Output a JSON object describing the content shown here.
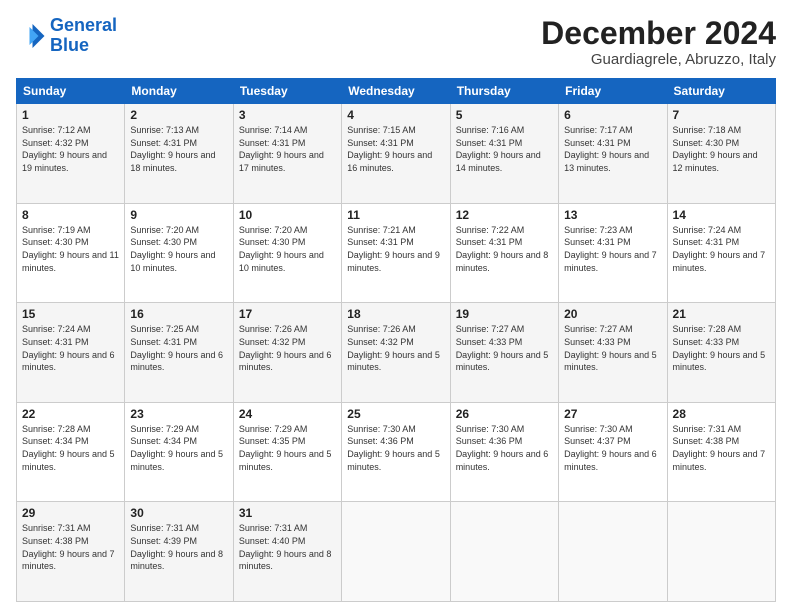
{
  "header": {
    "logo_line1": "General",
    "logo_line2": "Blue",
    "month": "December 2024",
    "location": "Guardiagrele, Abruzzo, Italy"
  },
  "weekdays": [
    "Sunday",
    "Monday",
    "Tuesday",
    "Wednesday",
    "Thursday",
    "Friday",
    "Saturday"
  ],
  "weeks": [
    [
      {
        "day": "1",
        "sunrise": "7:12 AM",
        "sunset": "4:32 PM",
        "daylight": "9 hours and 19 minutes."
      },
      {
        "day": "2",
        "sunrise": "7:13 AM",
        "sunset": "4:31 PM",
        "daylight": "9 hours and 18 minutes."
      },
      {
        "day": "3",
        "sunrise": "7:14 AM",
        "sunset": "4:31 PM",
        "daylight": "9 hours and 17 minutes."
      },
      {
        "day": "4",
        "sunrise": "7:15 AM",
        "sunset": "4:31 PM",
        "daylight": "9 hours and 16 minutes."
      },
      {
        "day": "5",
        "sunrise": "7:16 AM",
        "sunset": "4:31 PM",
        "daylight": "9 hours and 14 minutes."
      },
      {
        "day": "6",
        "sunrise": "7:17 AM",
        "sunset": "4:31 PM",
        "daylight": "9 hours and 13 minutes."
      },
      {
        "day": "7",
        "sunrise": "7:18 AM",
        "sunset": "4:30 PM",
        "daylight": "9 hours and 12 minutes."
      }
    ],
    [
      {
        "day": "8",
        "sunrise": "7:19 AM",
        "sunset": "4:30 PM",
        "daylight": "9 hours and 11 minutes."
      },
      {
        "day": "9",
        "sunrise": "7:20 AM",
        "sunset": "4:30 PM",
        "daylight": "9 hours and 10 minutes."
      },
      {
        "day": "10",
        "sunrise": "7:20 AM",
        "sunset": "4:30 PM",
        "daylight": "9 hours and 10 minutes."
      },
      {
        "day": "11",
        "sunrise": "7:21 AM",
        "sunset": "4:31 PM",
        "daylight": "9 hours and 9 minutes."
      },
      {
        "day": "12",
        "sunrise": "7:22 AM",
        "sunset": "4:31 PM",
        "daylight": "9 hours and 8 minutes."
      },
      {
        "day": "13",
        "sunrise": "7:23 AM",
        "sunset": "4:31 PM",
        "daylight": "9 hours and 7 minutes."
      },
      {
        "day": "14",
        "sunrise": "7:24 AM",
        "sunset": "4:31 PM",
        "daylight": "9 hours and 7 minutes."
      }
    ],
    [
      {
        "day": "15",
        "sunrise": "7:24 AM",
        "sunset": "4:31 PM",
        "daylight": "9 hours and 6 minutes."
      },
      {
        "day": "16",
        "sunrise": "7:25 AM",
        "sunset": "4:31 PM",
        "daylight": "9 hours and 6 minutes."
      },
      {
        "day": "17",
        "sunrise": "7:26 AM",
        "sunset": "4:32 PM",
        "daylight": "9 hours and 6 minutes."
      },
      {
        "day": "18",
        "sunrise": "7:26 AM",
        "sunset": "4:32 PM",
        "daylight": "9 hours and 5 minutes."
      },
      {
        "day": "19",
        "sunrise": "7:27 AM",
        "sunset": "4:33 PM",
        "daylight": "9 hours and 5 minutes."
      },
      {
        "day": "20",
        "sunrise": "7:27 AM",
        "sunset": "4:33 PM",
        "daylight": "9 hours and 5 minutes."
      },
      {
        "day": "21",
        "sunrise": "7:28 AM",
        "sunset": "4:33 PM",
        "daylight": "9 hours and 5 minutes."
      }
    ],
    [
      {
        "day": "22",
        "sunrise": "7:28 AM",
        "sunset": "4:34 PM",
        "daylight": "9 hours and 5 minutes."
      },
      {
        "day": "23",
        "sunrise": "7:29 AM",
        "sunset": "4:34 PM",
        "daylight": "9 hours and 5 minutes."
      },
      {
        "day": "24",
        "sunrise": "7:29 AM",
        "sunset": "4:35 PM",
        "daylight": "9 hours and 5 minutes."
      },
      {
        "day": "25",
        "sunrise": "7:30 AM",
        "sunset": "4:36 PM",
        "daylight": "9 hours and 5 minutes."
      },
      {
        "day": "26",
        "sunrise": "7:30 AM",
        "sunset": "4:36 PM",
        "daylight": "9 hours and 6 minutes."
      },
      {
        "day": "27",
        "sunrise": "7:30 AM",
        "sunset": "4:37 PM",
        "daylight": "9 hours and 6 minutes."
      },
      {
        "day": "28",
        "sunrise": "7:31 AM",
        "sunset": "4:38 PM",
        "daylight": "9 hours and 7 minutes."
      }
    ],
    [
      {
        "day": "29",
        "sunrise": "7:31 AM",
        "sunset": "4:38 PM",
        "daylight": "9 hours and 7 minutes."
      },
      {
        "day": "30",
        "sunrise": "7:31 AM",
        "sunset": "4:39 PM",
        "daylight": "9 hours and 8 minutes."
      },
      {
        "day": "31",
        "sunrise": "7:31 AM",
        "sunset": "4:40 PM",
        "daylight": "9 hours and 8 minutes."
      },
      null,
      null,
      null,
      null
    ]
  ]
}
